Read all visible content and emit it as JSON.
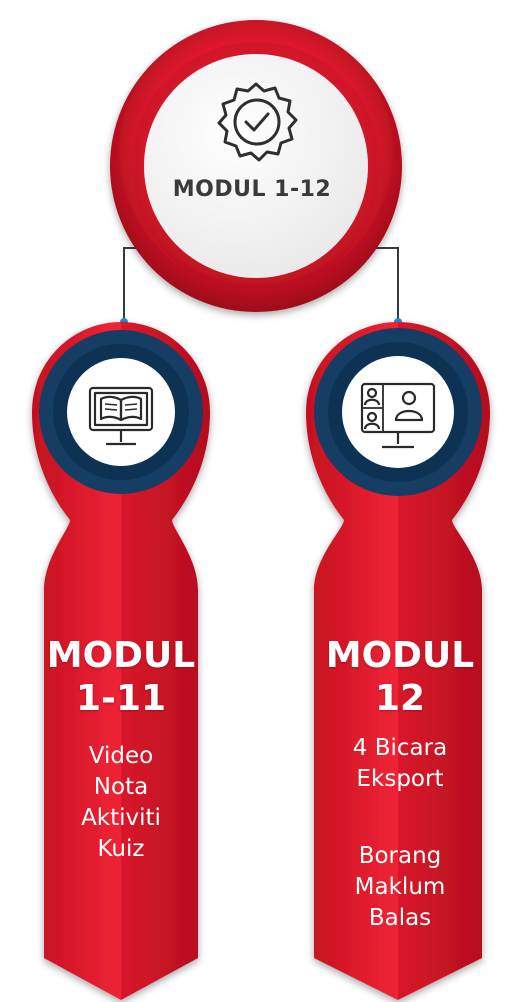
{
  "hub": {
    "title": "MODUL 1-12",
    "icon": "verified-badge-icon"
  },
  "modules": [
    {
      "title_line1": "MODUL",
      "title_line2": "1-11",
      "icon": "monitor-book-icon",
      "items": [
        "Video",
        "Nota",
        "Aktiviti",
        "Kuiz"
      ]
    },
    {
      "title_line1": "MODUL",
      "title_line2": "12",
      "icon": "monitor-video-call-icon",
      "items": [
        "4 Bicara",
        "Eksport",
        "Borang",
        "Maklum",
        "Balas"
      ]
    }
  ],
  "colors": {
    "red": "#e0182d",
    "dark_red": "#a50d1c",
    "navy": "#123c63",
    "connector": "#3a3a3a",
    "dot": "#1e90d8"
  }
}
